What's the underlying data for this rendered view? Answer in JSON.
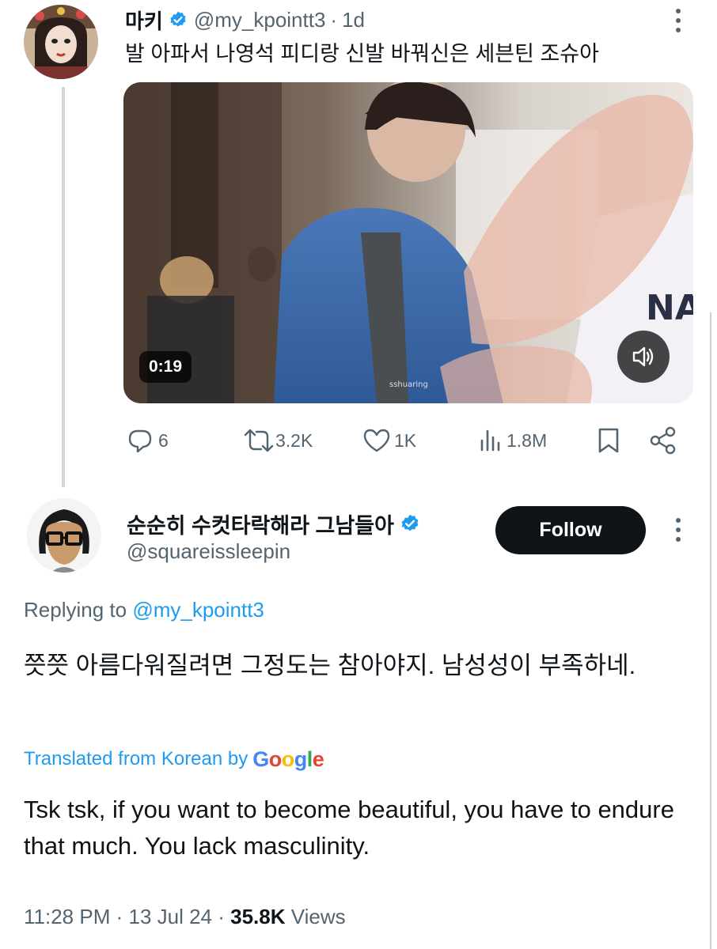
{
  "parent_tweet": {
    "display_name": "마키",
    "handle": "@my_kpointt3",
    "time_ago": "1d",
    "text": "발 아파서 나영석 피디랑 신발 바꿔신은 세븐틴 조슈아",
    "video": {
      "duration": "0:19",
      "watermark": "sshuaring"
    },
    "actions": {
      "replies": "6",
      "reposts": "3.2K",
      "likes": "1K",
      "views": "1.8M"
    }
  },
  "reply_tweet": {
    "display_name": "순순히 수컷타락해라 그남들아",
    "handle": "@squareissleepin",
    "follow_label": "Follow",
    "replying_prefix": "Replying to",
    "replying_handle": "@my_kpointt3",
    "text": "쯧쯧 아름다워질려면 그정도는 참아야지. 남성성이 부족하네.",
    "translated_label": "Translated from Korean by",
    "translator": "Google",
    "translation": "Tsk tsk, if you want to become beautiful, you have to endure that much. You lack masculinity.",
    "time": "11:28 PM",
    "date": "13 Jul 24",
    "views_count": "35.8K",
    "views_label": "Views"
  },
  "icons": [
    "verified-badge-icon",
    "more-icon",
    "reply-icon",
    "repost-icon",
    "like-icon",
    "views-icon",
    "bookmark-icon",
    "share-icon",
    "volume-icon"
  ],
  "colors": {
    "accent": "#1d9bf0",
    "text": "#0f1419",
    "secondary_text": "#536471",
    "follow_button": "#0f1419",
    "thread_line": "#cfd9de"
  }
}
